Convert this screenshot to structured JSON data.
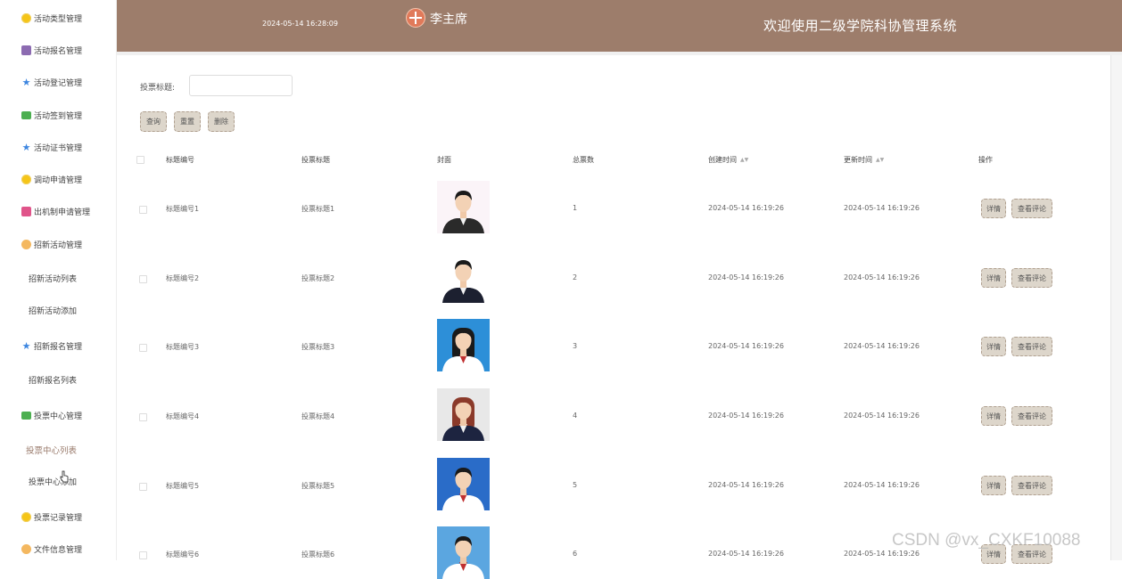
{
  "sidebar": {
    "items": [
      {
        "label": "活动类型管理",
        "icon": "sun-icon"
      },
      {
        "label": "活动报名管理",
        "icon": "box-icon"
      },
      {
        "label": "活动登记管理",
        "icon": "star-icon"
      },
      {
        "label": "活动签到管理",
        "icon": "message-icon"
      },
      {
        "label": "活动证书管理",
        "icon": "star-icon"
      },
      {
        "label": "调动申请管理",
        "icon": "sun-icon"
      },
      {
        "label": "出机制申请管理",
        "icon": "pink-box-icon"
      },
      {
        "label": "招新活动管理",
        "icon": "flower-icon"
      },
      {
        "label": "招新报名管理",
        "icon": "star-icon"
      },
      {
        "label": "投票中心管理",
        "icon": "message-icon"
      },
      {
        "label": "投票记录管理",
        "icon": "sun-icon"
      },
      {
        "label": "文件信息管理",
        "icon": "flower-icon"
      }
    ],
    "subitems": {
      "recruit_list": "招新活动列表",
      "recruit_add": "招新活动添加",
      "recruit_signup_list": "招新报名列表",
      "vote_list": "投票中心列表",
      "vote_add": "投票中心添加"
    }
  },
  "header": {
    "datetime": "2024-05-14 16:28:09",
    "user": "李主席",
    "title": "欢迎使用二级学院科协管理系统"
  },
  "search": {
    "label": "投票标题:",
    "value": "",
    "placeholder": ""
  },
  "toolbar": {
    "query_label": "查询",
    "reset_label": "重置",
    "delete_label": "删除"
  },
  "table": {
    "columns": [
      "标题编号",
      "投票标题",
      "封面",
      "总票数",
      "创建时间",
      "更新时间",
      "操作"
    ],
    "rows": [
      {
        "code": "标题编号1",
        "title": "投票标题1",
        "votes": "1",
        "created": "2024-05-14 16:19:26",
        "updated": "2024-05-14 16:19:26"
      },
      {
        "code": "标题编号2",
        "title": "投票标题2",
        "votes": "2",
        "created": "2024-05-14 16:19:26",
        "updated": "2024-05-14 16:19:26"
      },
      {
        "code": "标题编号3",
        "title": "投票标题3",
        "votes": "3",
        "created": "2024-05-14 16:19:26",
        "updated": "2024-05-14 16:19:26"
      },
      {
        "code": "标题编号4",
        "title": "投票标题4",
        "votes": "4",
        "created": "2024-05-14 16:19:26",
        "updated": "2024-05-14 16:19:26"
      },
      {
        "code": "标题编号5",
        "title": "投票标题5",
        "votes": "5",
        "created": "2024-05-14 16:19:26",
        "updated": "2024-05-14 16:19:26"
      },
      {
        "code": "标题编号6",
        "title": "投票标题6",
        "votes": "6",
        "created": "2024-05-14 16:19:26",
        "updated": "2024-05-14 16:19:26"
      }
    ],
    "detail_label": "详情",
    "comment_label": "查看评论"
  },
  "watermark": "CSDN @vx_CXKF10088",
  "colors": {
    "header_bg": "#9d7d6b",
    "button_bg": "#ddd6cb",
    "active_menu": "#9a7b6c"
  }
}
